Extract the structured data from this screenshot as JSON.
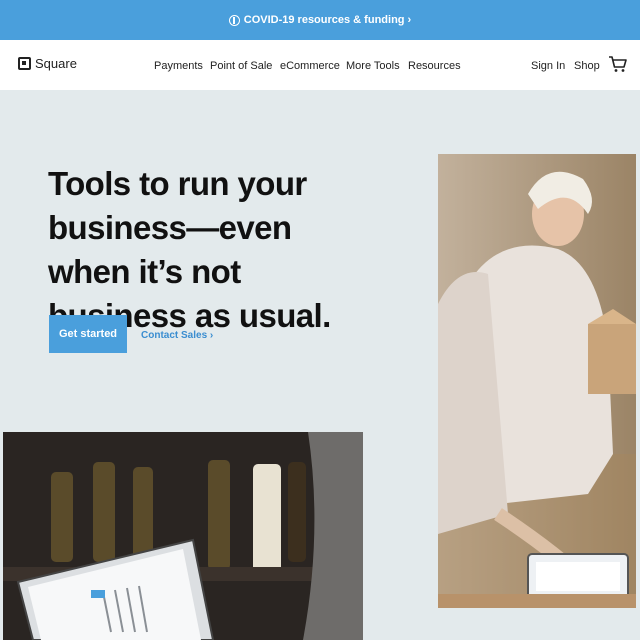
{
  "banner": {
    "text": "COVID-19 resources & funding ›"
  },
  "nav": {
    "logo_text": "Square",
    "links": [
      "Payments",
      "Point of Sale",
      "eCommerce",
      "More Tools",
      "Resources"
    ],
    "sign_in": "Sign In",
    "shop": "Shop"
  },
  "hero": {
    "title": "Tools to run your business—even when it’s not business as usual.",
    "primary_cta": "Get started",
    "secondary_cta": "Contact Sales ›"
  },
  "colors": {
    "accent": "#4a9fdc",
    "background": "#e3eaec",
    "link": "#3a8dd0"
  }
}
